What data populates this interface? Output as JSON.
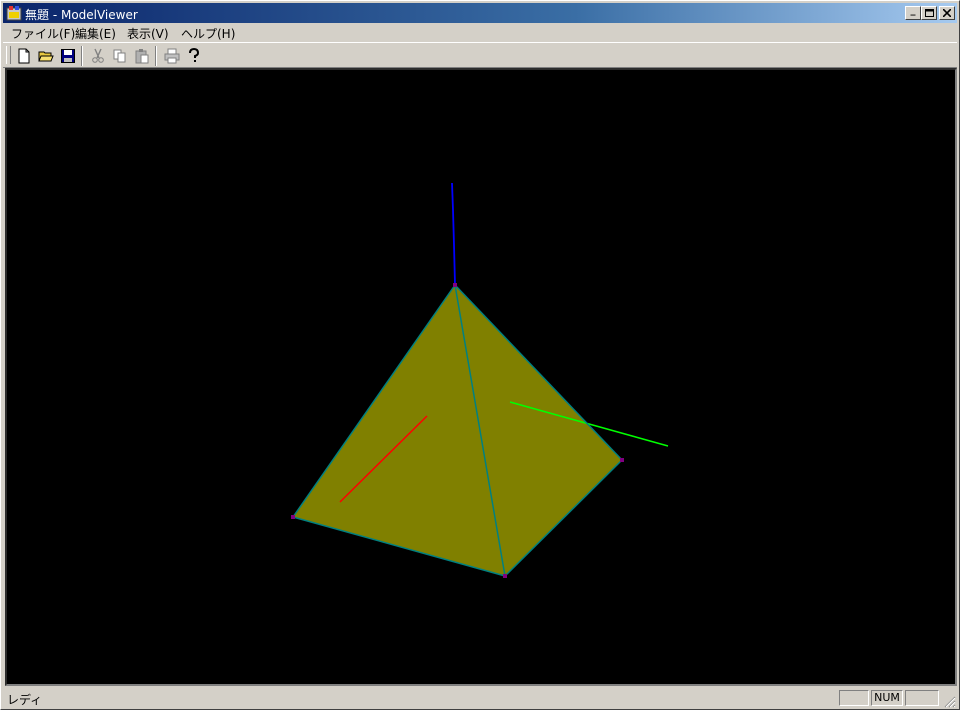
{
  "window": {
    "title": "無題 - ModelViewer"
  },
  "titlebar_buttons": [
    {
      "name": "minimize-button",
      "glyph": "_"
    },
    {
      "name": "maximize-button",
      "glyph": "□"
    },
    {
      "name": "close-button",
      "glyph": "×"
    }
  ],
  "menu": [
    "ファイル(F)",
    "編集(E)",
    "表示(V)",
    "ヘルプ(H)"
  ],
  "toolbar": {
    "buttons": [
      "new-file-icon",
      "open-folder-icon",
      "save-icon",
      "cut-icon",
      "copy-icon",
      "paste-icon",
      "print-icon",
      "help-icon"
    ]
  },
  "scene": {
    "background": "#000000",
    "face_color": "#808000",
    "edge_color": "#008080",
    "vertex_color": "#800080",
    "axis_colors": {
      "x": "#ff0000",
      "y": "#00ff00",
      "z": "#0000ff"
    }
  },
  "status": {
    "text": "レディ",
    "num_indicator": "NUM"
  }
}
